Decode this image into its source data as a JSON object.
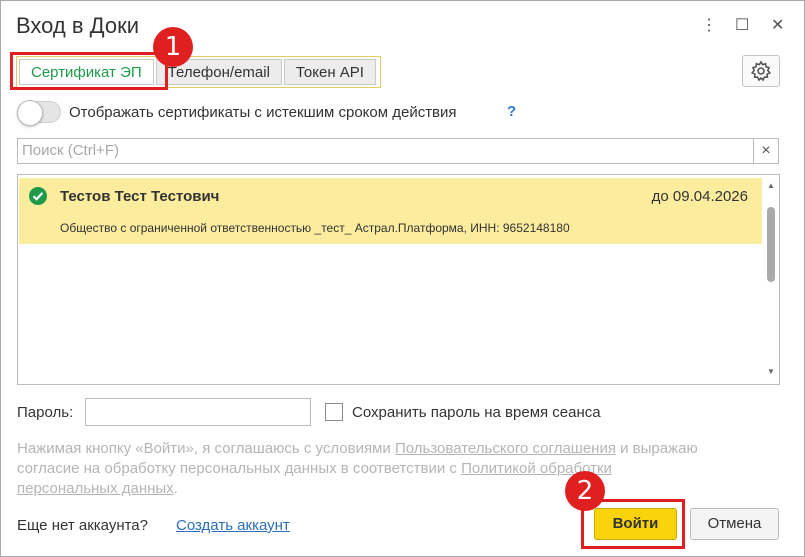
{
  "window": {
    "title": "Вход в Доки",
    "menu_glyph": "⋮",
    "maximize_glyph": "☐",
    "close_glyph": "✕"
  },
  "tabs": [
    {
      "label": "Сертификат ЭП",
      "active": true
    },
    {
      "label": "Телефон/email",
      "active": false
    },
    {
      "label": "Токен API",
      "active": false
    }
  ],
  "badges": {
    "one": "1",
    "two": "2"
  },
  "toggle": {
    "label": "Отображать сертификаты с истекшим сроком действия",
    "help": "?",
    "checked": false
  },
  "search": {
    "placeholder": "Поиск (Ctrl+F)",
    "clear": "×"
  },
  "certificates": [
    {
      "name": "Тестов Тест Тестович",
      "expiry": "до 09.04.2026",
      "org": "Общество с ограниченной ответственностью _тест_ Астрал.Платформа, ИНН: 9652148180",
      "selected": true
    }
  ],
  "password": {
    "label": "Пароль:",
    "value": ""
  },
  "save_password": {
    "label": "Сохранить пароль на время сеанса",
    "checked": false
  },
  "terms": {
    "text1": "Нажимая кнопку «Войти», я соглашаюсь с условиями ",
    "link1": "Пользовательского соглашения",
    "text2": " и выражаю согласие на обработку персональных данных в соответствии с ",
    "link2": "Политикой обработки персональных данных",
    "text3": "."
  },
  "footer": {
    "no_account": "Еще нет аккаунта?",
    "create_account": "Создать аккаунт",
    "login": "Войти",
    "cancel": "Отмена"
  },
  "colors": {
    "accent_green": "#1f9a4a",
    "highlight": "#fbec9e",
    "primary_button": "#f9d40c",
    "annotation_red": "#e02020"
  }
}
